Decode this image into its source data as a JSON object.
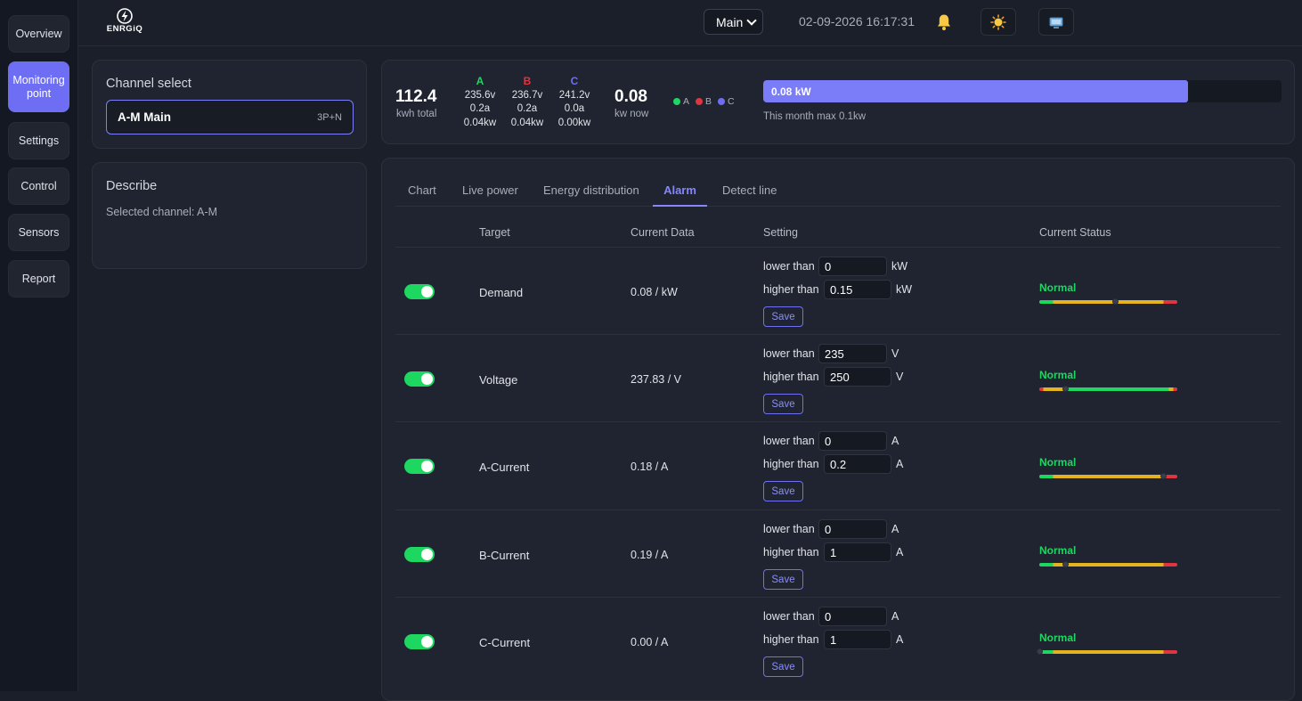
{
  "sidebar": {
    "items": [
      {
        "label": "Overview"
      },
      {
        "label": "Monitoring point"
      },
      {
        "label": "Settings"
      },
      {
        "label": "Control"
      },
      {
        "label": "Sensors"
      },
      {
        "label": "Report"
      }
    ]
  },
  "header": {
    "logo_text": "ENRGiQ",
    "site_select": "Main",
    "datetime": "02-09-2026 16:17:31"
  },
  "channel": {
    "title": "Channel select",
    "name": "A-M Main",
    "type": "3P+N"
  },
  "describe": {
    "title": "Describe",
    "text": "Selected channel: A-M"
  },
  "summary": {
    "total_value": "112.4",
    "total_label": "kwh total",
    "phases": [
      {
        "name": "A",
        "color": "#1ed760",
        "voltage": "235.6v",
        "current": "0.2a",
        "power": "0.04kw"
      },
      {
        "name": "B",
        "color": "#e0343f",
        "voltage": "236.7v",
        "current": "0.2a",
        "power": "0.04kw"
      },
      {
        "name": "C",
        "color": "#6e6ef5",
        "voltage": "241.2v",
        "current": "0.0a",
        "power": "0.00kw"
      }
    ],
    "now_value": "0.08",
    "now_label": "kw now",
    "legend": [
      "A",
      "B",
      "C"
    ],
    "bar_label": "0.08 kW",
    "bar_fraction": 0.82,
    "month_max": "This month max 0.1kw"
  },
  "tabs": [
    "Chart",
    "Live power",
    "Energy distribution",
    "Alarm",
    "Detect line"
  ],
  "table": {
    "headers": {
      "target": "Target",
      "current": "Current Data",
      "setting": "Setting",
      "status": "Current Status"
    },
    "lower_label": "lower than",
    "higher_label": "higher than",
    "save_label": "Save",
    "rows": [
      {
        "target": "Demand",
        "current": "0.08 / kW",
        "lower": "0",
        "higher": "0.15",
        "unit": "kW",
        "status": "Normal",
        "marker": 0.55
      },
      {
        "target": "Voltage",
        "current": "237.83 / V",
        "lower": "235",
        "higher": "250",
        "unit": "V",
        "status": "Normal",
        "marker": 0.19
      },
      {
        "target": "A-Current",
        "current": "0.18 / A",
        "lower": "0",
        "higher": "0.2",
        "unit": "A",
        "status": "Normal",
        "marker": 0.9
      },
      {
        "target": "B-Current",
        "current": "0.19 / A",
        "lower": "0",
        "higher": "1",
        "unit": "A",
        "status": "Normal",
        "marker": 0.19
      },
      {
        "target": "C-Current",
        "current": "0.00 / A",
        "lower": "0",
        "higher": "1",
        "unit": "A",
        "status": "Normal",
        "marker": 0.0
      }
    ]
  }
}
